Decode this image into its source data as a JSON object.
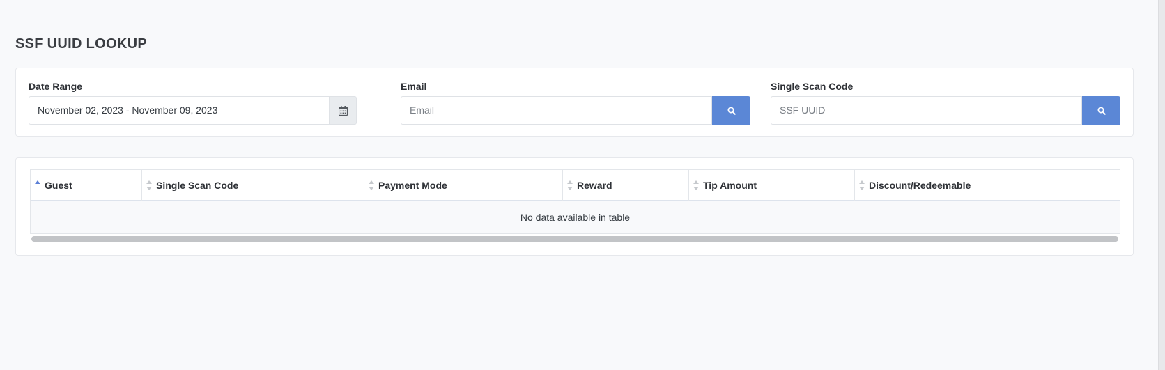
{
  "page": {
    "title": "SSF UUID LOOKUP"
  },
  "filters": {
    "date_range": {
      "label": "Date Range",
      "value": "November 02, 2023 - November 09, 2023",
      "icon": "calendar-icon"
    },
    "email": {
      "label": "Email",
      "placeholder": "Email",
      "button_icon": "search-icon"
    },
    "single_scan_code": {
      "label": "Single Scan Code",
      "placeholder": "SSF UUID",
      "button_icon": "search-icon"
    }
  },
  "table": {
    "columns": [
      {
        "label": "Guest",
        "sort": "ascending"
      },
      {
        "label": "Single Scan Code",
        "sort": "none"
      },
      {
        "label": "Payment Mode",
        "sort": "none"
      },
      {
        "label": "Reward",
        "sort": "none"
      },
      {
        "label": "Tip Amount",
        "sort": "none"
      },
      {
        "label": "Discount/Redeemable",
        "sort": "none"
      }
    ],
    "empty_message": "No data available in table"
  },
  "colors": {
    "primary_button": "#5b87d6",
    "sort_active": "#5b7fd6",
    "sort_inactive": "#c6c9cd"
  }
}
